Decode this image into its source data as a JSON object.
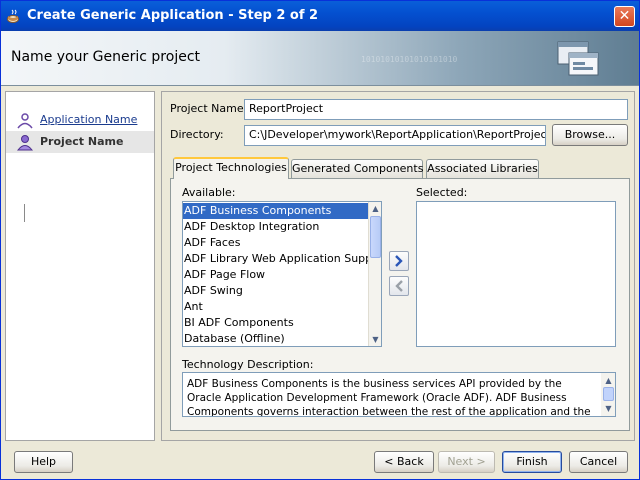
{
  "window": {
    "title": "Create Generic Application - Step 2 of 2"
  },
  "banner": {
    "title": "Name your Generic project",
    "binary_text": "10101010101010101010"
  },
  "nav": {
    "items": [
      {
        "label": "Application Name"
      },
      {
        "label": "Project Name"
      }
    ]
  },
  "form": {
    "project_name_label": "Project Name:",
    "project_name_value": "ReportProject",
    "directory_label": "Directory:",
    "directory_value": "C:\\JDeveloper\\mywork\\ReportApplication\\ReportProject",
    "browse_label": "Browse..."
  },
  "tabs": [
    {
      "label": "Project Technologies",
      "active": true
    },
    {
      "label": "Generated Components",
      "active": false
    },
    {
      "label": "Associated Libraries",
      "active": false
    }
  ],
  "available": {
    "label": "Available:",
    "items": [
      "ADF Business Components",
      "ADF Desktop Integration",
      "ADF Faces",
      "ADF Library Web Application Support",
      "ADF Page Flow",
      "ADF Swing",
      "Ant",
      "BI ADF Components",
      "Database (Offline)"
    ],
    "selected_index": 0
  },
  "selected": {
    "label": "Selected:"
  },
  "description": {
    "label": "Technology Description:",
    "text": "ADF Business Components is the business services API provided by the Oracle Application Development Framework (Oracle ADF).  ADF Business Components governs interaction between the rest of the application and the data stored in the"
  },
  "footer": {
    "help": "Help",
    "back": "< Back",
    "next": "Next >",
    "finish": "Finish",
    "cancel": "Cancel"
  },
  "colors": {
    "titlebar": "#0450d0",
    "selection": "#316ac5",
    "active_tab": "#ffc83c"
  }
}
